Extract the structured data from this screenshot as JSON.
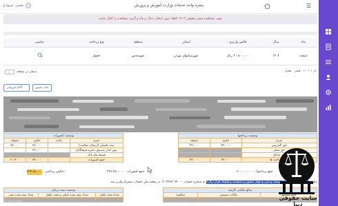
{
  "topbar": {
    "title": "پنجره واحد خدمات وزارت آموزش و پرورش",
    "user_name": "مجتبی",
    "user_prefix": "خروج از",
    "menu_glyph": "☰"
  },
  "notice": "جهت مشاهده فیش حقوقی ۱۴۰۳ لطفا بدون انتخاب سال و ماه و گزینه مشاهده را کلیک نمایید",
  "table": {
    "headers": [
      "ماه",
      "سال",
      "خالص واریزی",
      "استان",
      "منطقه",
      "نوع پرداخت",
      "نمایش"
    ],
    "row": [
      "اسفند",
      "۱۴۰۲",
      "۲۰،۸۰۰،۰۰۰ ریال",
      "شهرستانهای تهران",
      "شهرقدس",
      "حقوق",
      ""
    ]
  },
  "pager": {
    "page_size": "۱۰",
    "rows_label": "سطر در صفحه",
    "range": "۱ - ۱ از ۱",
    "prev": "قبلی",
    "next": "بعدی"
  },
  "buttons": {
    "print": "چاپ فیش",
    "pdf": "خروجی pdf"
  },
  "left_table": {
    "title": "وضعیت کسورات",
    "headers": [
      "معوقه",
      "جاری",
      "مانده",
      "شرح"
    ],
    "rows": [
      [
        "۳۸،۰۰۰",
        "۳۸،۰۰۰",
        "",
        "بیمه تکمیلی (ارمغان سلامت)"
      ],
      [
        "",
        "۲۳،۰۰۰",
        "",
        "پس انداز صندوق ذخیره فرهنگیان"
      ],
      [
        "",
        "",
        "",
        "قسط وام بانک"
      ]
    ],
    "total": [
      "۲۰،۴۰۰",
      "۳۸،۰۰۰",
      "",
      "جمع کسورات"
    ]
  },
  "right_table": {
    "title": "وضعیت پرداختها",
    "headers": [
      "معوقه",
      "جاری",
      "شرح"
    ],
    "rows": [
      [
        "۴۳،۰۰۰",
        "۴۳،۰۰۰",
        "حق التدریس"
      ],
      [
        "",
        "",
        "حق شغل"
      ],
      [
        "",
        "",
        "حق شاغل"
      ]
    ],
    "total": [
      "۴۳،۰۰۰",
      "۴۳،۰۰۰",
      "جمع پرداخت ها"
    ]
  },
  "sum_line": {
    "net_label": "خالص پرداختی :",
    "net_value": "۲۳۴،۶۸۰،۰۰۰",
    "mid": "جمع کسورات : ۳۴۷،۳۵۰،۰۰۰",
    "right": "جمع پرداختها : ۶۰۰،۰۰۰،۰۰۰"
  },
  "info_line": {
    "pre": "مبلغ : ",
    "highlight": "۲۳۴،۶۸۰،۰۰۰ ریال (دویست و سی و چهار میلیون و ششصد و هشتاد هزار ریال)",
    "post": " به شماره حساب ۰۳۰۳۴۷۳۰۷۴۰۰۰ در شعبه ملی حساب متمرکز واریز شد."
  },
  "bottom_left": {
    "title": "وضعیت بیمه درمان",
    "headers": [
      "تعداد بیمه شده تبعی",
      "تعداد بیمه شده اصلی و تحت تکفل",
      "تعداد تحت تکفل"
    ]
  },
  "bottom_right": {
    "title": "مبالغ مالیاتی کارمند",
    "headers": [
      "جمع مشمول",
      "مالیات مستمر",
      "معافیت"
    ]
  },
  "watermark": {
    "text": "سایت حقوقی دیبا",
    "corner": "©eshdiba"
  }
}
